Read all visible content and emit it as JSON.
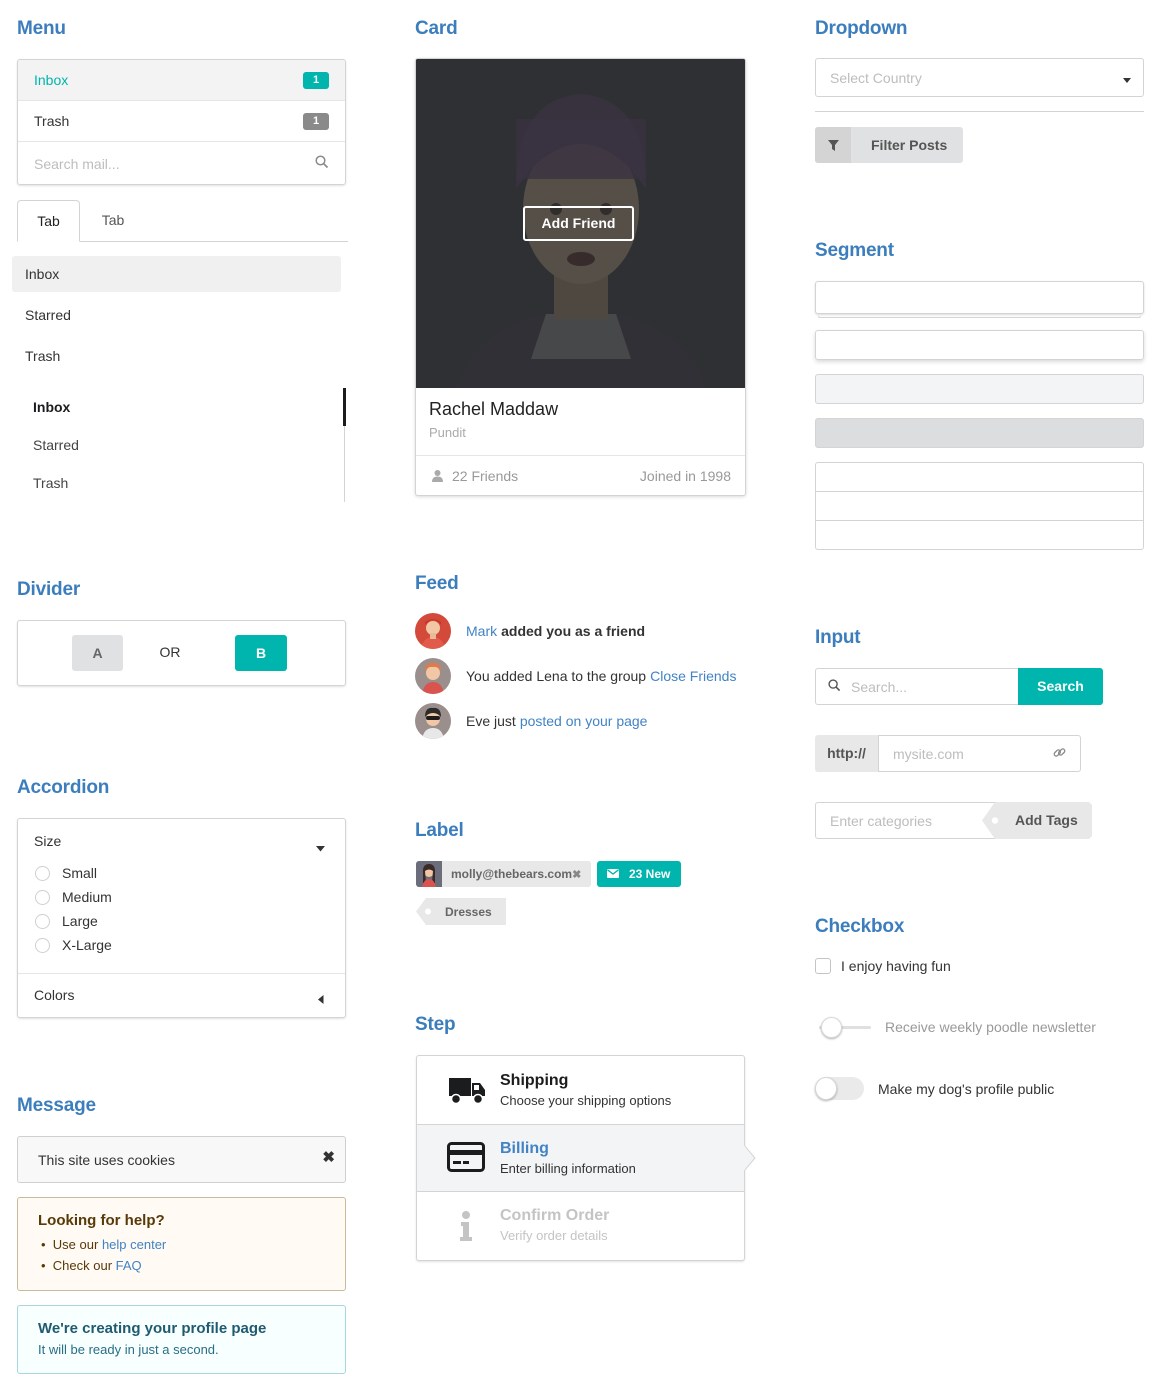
{
  "headings": {
    "menu": "Menu",
    "card": "Card",
    "dropdown": "Dropdown",
    "segment": "Segment",
    "divider": "Divider",
    "feed": "Feed",
    "input": "Input",
    "accordion": "Accordion",
    "label": "Label",
    "checkbox": "Checkbox",
    "step": "Step",
    "message": "Message"
  },
  "menu": {
    "items": [
      {
        "label": "Inbox",
        "count": "1",
        "badge_color": "#00b5ad",
        "active": true
      },
      {
        "label": "Trash",
        "count": "1",
        "badge_color": "#8a8a8a",
        "active": false
      }
    ],
    "search_placeholder": "Search mail...",
    "search_icon": "search-icon"
  },
  "tabs": {
    "items": [
      "Tab",
      "Tab"
    ],
    "active_index": 0
  },
  "vertical_menu": {
    "items": [
      "Inbox",
      "Starred",
      "Trash"
    ],
    "active_index": 0
  },
  "vertical_tabs": {
    "items": [
      "Inbox",
      "Starred",
      "Trash"
    ],
    "active_index": 0
  },
  "divider": {
    "a_label": "A",
    "or_label": "OR",
    "b_label": "B"
  },
  "accordion": {
    "title": "Size",
    "options": [
      "Small",
      "Medium",
      "Large",
      "X-Large"
    ],
    "second_title": "Colors"
  },
  "message": {
    "cookies": "This site uses cookies",
    "help_title": "Looking for help?",
    "help_item1_prefix": "Use our",
    "help_item1_link": "help center",
    "help_item2_prefix": "Check our",
    "help_item2_link": "FAQ",
    "profile_title": "We're creating your profile page",
    "profile_text": "It will be ready in just a second."
  },
  "card": {
    "overlay_button": "Add Friend",
    "name": "Rachel Maddaw",
    "role": "Pundit",
    "friends": "22 Friends",
    "joined": "Joined in 1998"
  },
  "feed": {
    "items": [
      {
        "link": "Mark",
        "text": "added you as a friend"
      },
      {
        "text": "You added Lena to the group",
        "link": "Close Friends"
      },
      {
        "text": "Eve just",
        "link": "posted on your page"
      }
    ]
  },
  "label": {
    "email": "molly@thebears.com",
    "new_count": "23 New",
    "tag": "Dresses"
  },
  "step": {
    "items": [
      {
        "title": "Shipping",
        "desc": "Choose your shipping options",
        "icon": "truck-icon",
        "state": "completed"
      },
      {
        "title": "Billing",
        "desc": "Enter billing information",
        "icon": "credit-card-icon",
        "state": "active"
      },
      {
        "title": "Confirm Order",
        "desc": "Verify order details",
        "icon": "info-icon",
        "state": "disabled"
      }
    ]
  },
  "dropdown": {
    "placeholder": "Select Country",
    "filter_button": "Filter Posts"
  },
  "input": {
    "search_placeholder": "Search...",
    "search_button": "Search",
    "url_prefix": "http://",
    "url_placeholder": "mysite.com",
    "tags_placeholder": "Enter categories",
    "tags_button": "Add Tags"
  },
  "checkbox": {
    "items": [
      {
        "label": "I enjoy having fun",
        "type": "checkbox",
        "checked": false
      },
      {
        "label": "Receive weekly poodle newsletter",
        "type": "slider",
        "checked": false
      },
      {
        "label": "Make my dog's profile public",
        "type": "toggle",
        "checked": false
      }
    ]
  },
  "colors": {
    "accent": "#00b5ad",
    "heading": "#3c7ebd",
    "link": "#4183c4"
  }
}
